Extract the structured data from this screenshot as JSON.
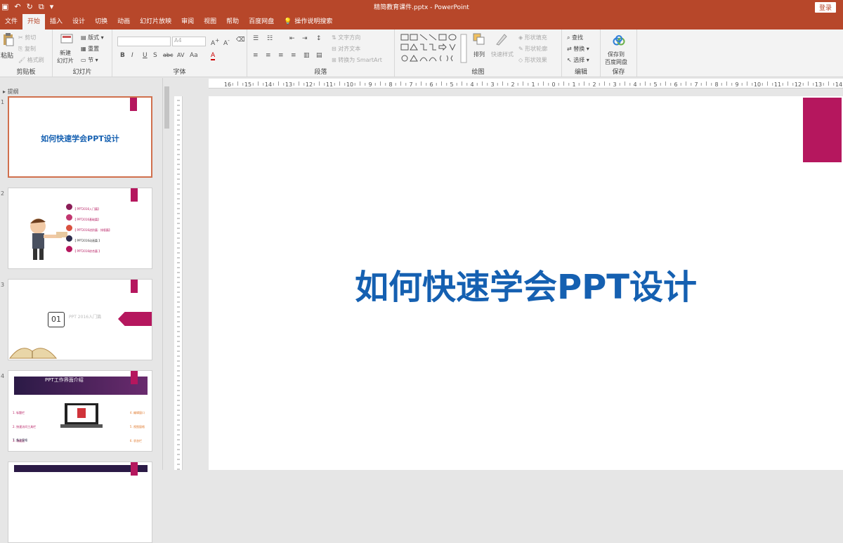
{
  "window": {
    "doc_title": "精简教育课件.pptx  -  PowerPoint",
    "login": "登录"
  },
  "tabs": [
    "文件",
    "开始",
    "插入",
    "设计",
    "切换",
    "动画",
    "幻灯片放映",
    "审阅",
    "视图",
    "帮助",
    "百度网盘"
  ],
  "help_search": "操作说明搜索",
  "ribbon": {
    "clipboard": {
      "label": "剪贴板",
      "paste": "粘贴",
      "cut": "剪切",
      "copy": "复制",
      "format_painter": "格式刷"
    },
    "slides": {
      "label": "幻灯片",
      "new_slide": "新建\n幻灯片",
      "layout": "版式",
      "reset": "重置",
      "section": "节"
    },
    "font": {
      "label": "字体",
      "size": "A4",
      "bold": "B",
      "italic": "I",
      "underline": "U",
      "shadow": "S",
      "strike": "abc",
      "spacing": "AV",
      "case": "Aa",
      "color": "A"
    },
    "paragraph": {
      "label": "段落",
      "text_direction": "文字方向",
      "align_text": "对齐文本",
      "smartart": "转换为 SmartArt"
    },
    "drawing": {
      "label": "绘图",
      "arrange": "排列",
      "quick_styles": "快速样式",
      "fill": "形状填充",
      "outline": "形状轮廓",
      "effects": "形状效果"
    },
    "editing": {
      "label": "编辑",
      "find": "查找",
      "replace": "替换",
      "select": "选择"
    },
    "save": {
      "label": "保存",
      "save_to_baidu": "保存到\n百度网盘"
    }
  },
  "outline_label": "提纲",
  "ruler_ticks": [
    "16",
    "15",
    "14",
    "13",
    "12",
    "11",
    "10",
    "9",
    "8",
    "7",
    "6",
    "5",
    "4",
    "3",
    "2",
    "1",
    "0",
    "1",
    "2",
    "3",
    "4",
    "5",
    "6",
    "7",
    "8",
    "9",
    "10",
    "11",
    "12",
    "13",
    "14",
    "15",
    "16"
  ],
  "slides": [
    {
      "num": "1",
      "title": "如何快速学会PPT设计"
    },
    {
      "num": "2",
      "items": [
        "【 PPT2016入门篇】",
        "【 PPT2016基础篇】",
        "【 PPT2016进阶篇 · 排版篇】",
        "【 PPT2016动画篇 】",
        "【 PPT2016综合篇 】"
      ]
    },
    {
      "num": "3",
      "section_no": "01",
      "section_title": "PPT 2016入门篇"
    },
    {
      "num": "4",
      "header": "PPT工作界面介绍",
      "labels": [
        "1. 标题栏",
        "2. 快速访问工具栏",
        "3. 功能区",
        "4. 编辑窗口",
        "5. 视图窗格",
        "6. 状态栏",
        "7. 备注窗格"
      ]
    }
  ],
  "colors": {
    "accent": "#b7472a",
    "magenta": "#b5175e",
    "title_blue": "#1560b1"
  },
  "canvas": {
    "title": "如何快速学会PPT设计"
  }
}
